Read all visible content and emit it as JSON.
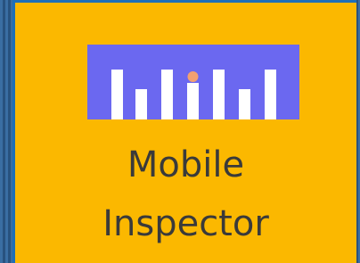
{
  "tile": {
    "title_line_1": "Mobile",
    "title_line_2": "Inspector",
    "icon": "bar-chart-logo-icon",
    "background_color": "#fbb800",
    "logo_background_color": "#6b68f0",
    "logo_bar_color": "#ffffff",
    "logo_dot_color": "#f3a070"
  }
}
